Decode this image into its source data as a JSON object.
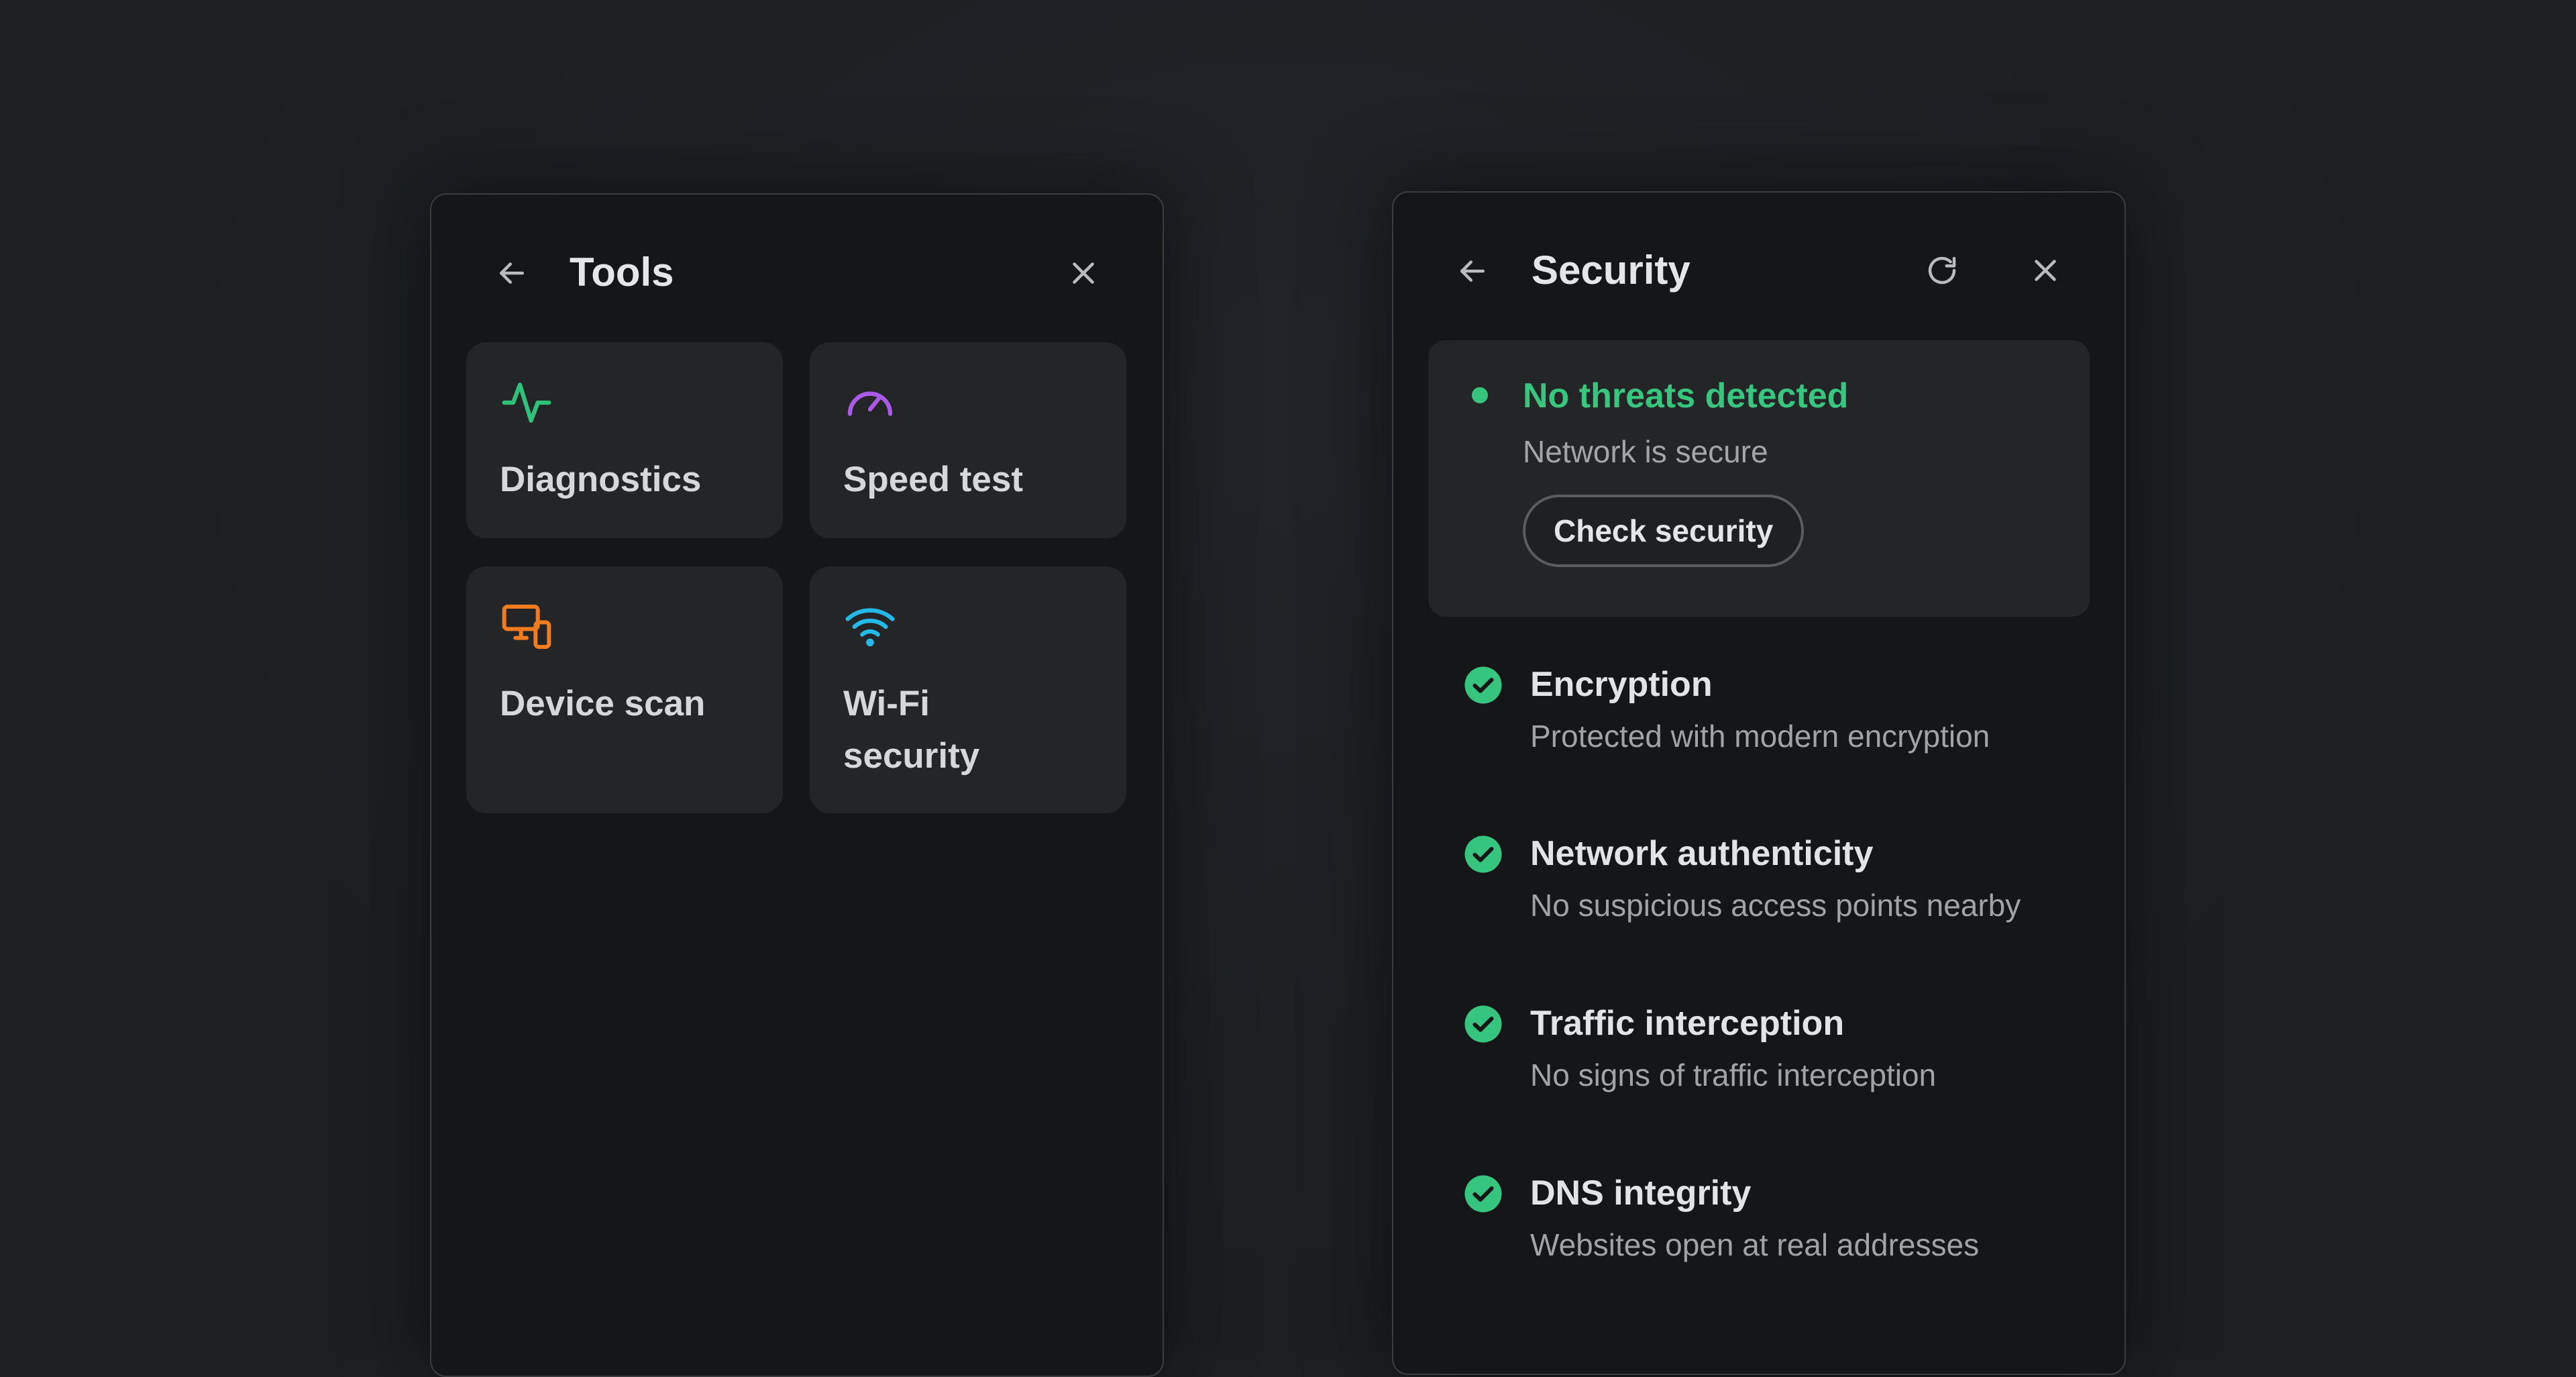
{
  "tools": {
    "title": "Tools",
    "tiles": [
      {
        "label": "Diagnostics",
        "icon": "activity-pulse-icon",
        "color": "#2fc07a"
      },
      {
        "label": "Speed test",
        "icon": "speedometer-icon",
        "color": "#a95be8"
      },
      {
        "label": "Device scan",
        "icon": "devices-icon",
        "color": "#f07c1f"
      },
      {
        "label": "Wi-Fi security",
        "icon": "wifi-icon",
        "color": "#23b9e8"
      }
    ]
  },
  "security": {
    "title": "Security",
    "status": {
      "title": "No threats detected",
      "subtitle": "Network is secure",
      "button": "Check security",
      "color": "#36c57f"
    },
    "checks": [
      {
        "title": "Encryption",
        "desc": "Protected with modern encryption"
      },
      {
        "title": "Network authenticity",
        "desc": "No suspicious access points nearby"
      },
      {
        "title": "Traffic interception",
        "desc": "No signs of traffic interception"
      },
      {
        "title": "DNS integrity",
        "desc": "Websites open at real addresses"
      }
    ]
  }
}
